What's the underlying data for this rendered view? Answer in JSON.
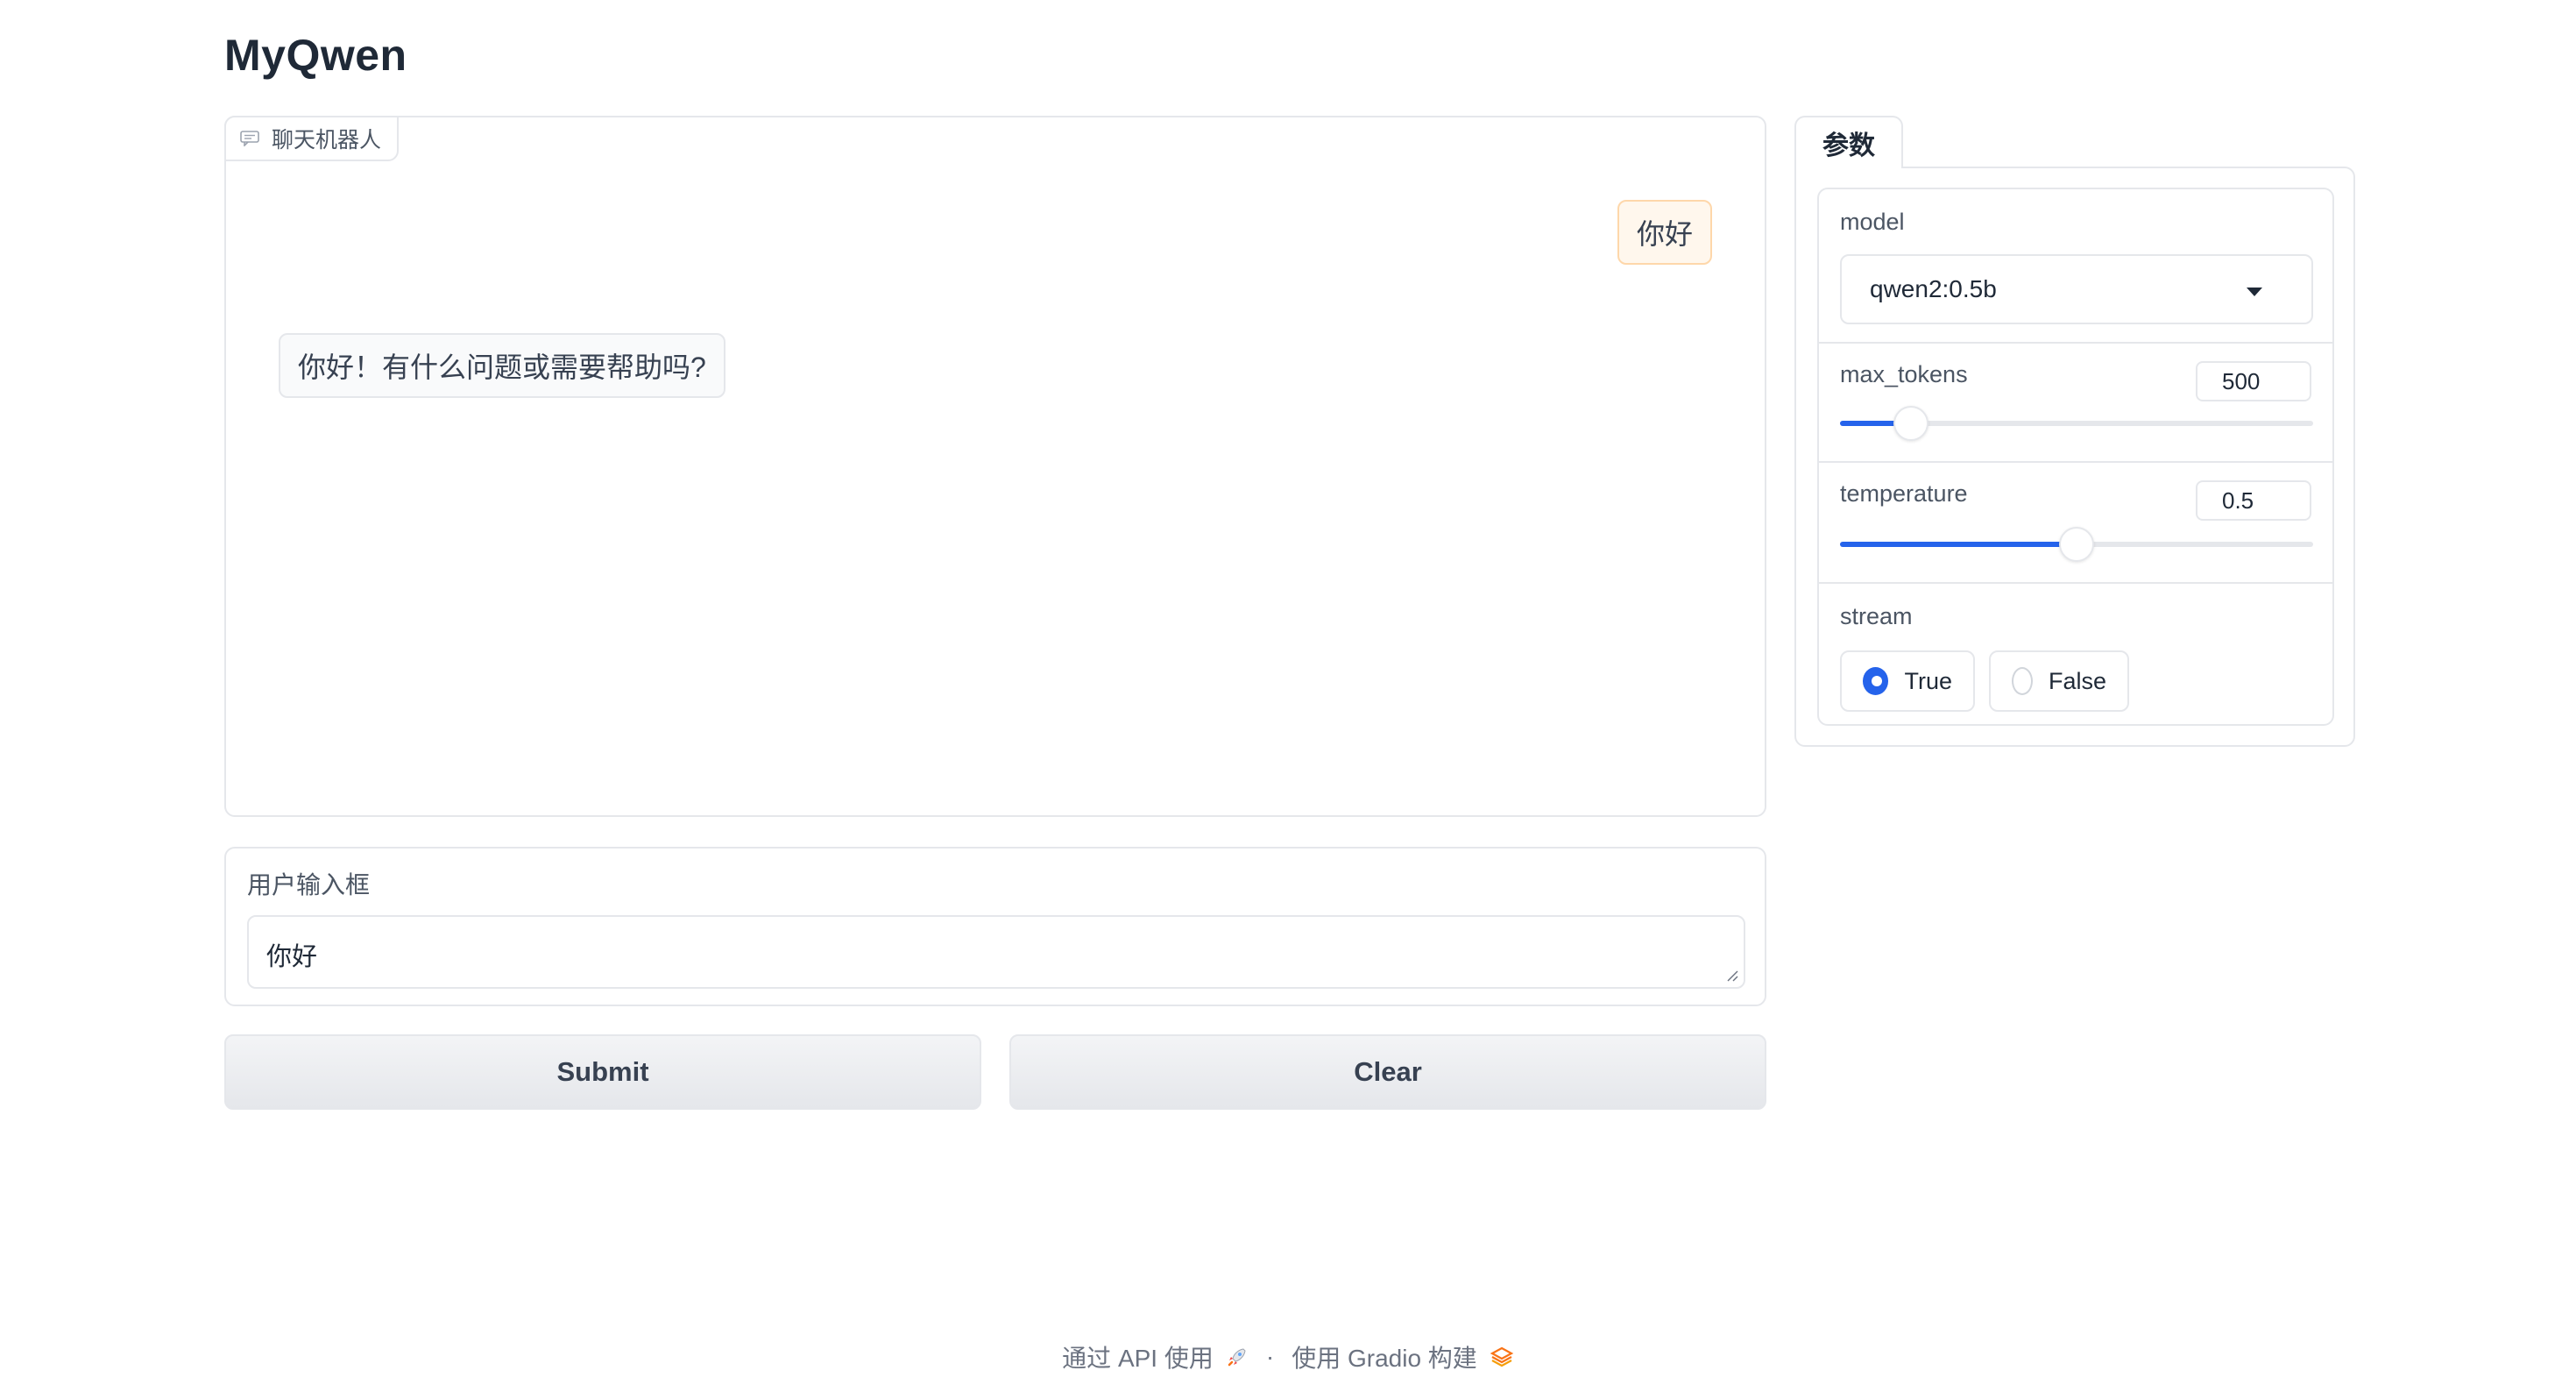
{
  "app": {
    "title": "MyQwen"
  },
  "chatbot": {
    "label": "聊天机器人",
    "messages": [
      {
        "role": "user",
        "text": "你好"
      },
      {
        "role": "bot",
        "text": "你好！有什么问题或需要帮助吗?"
      }
    ]
  },
  "input": {
    "label": "用户输入框",
    "value": "你好"
  },
  "buttons": {
    "submit": "Submit",
    "clear": "Clear"
  },
  "params": {
    "tab_label": "参数",
    "model": {
      "label": "model",
      "value": "qwen2:0.5b"
    },
    "max_tokens": {
      "label": "max_tokens",
      "value": "500",
      "fraction": 0.15
    },
    "temperature": {
      "label": "temperature",
      "value": "0.5",
      "fraction": 0.5
    },
    "stream": {
      "label": "stream",
      "options": [
        "True",
        "False"
      ],
      "selected": "True"
    }
  },
  "footer": {
    "api_text": "通过 API 使用",
    "separator": "·",
    "built_text": "使用 Gradio 构建"
  },
  "colors": {
    "accent": "#2563eb",
    "user_bubble": "#fff7ed",
    "gradio_logo": "#f97316"
  },
  "icons": [
    "chat-bubble-icon",
    "chevron-down-icon",
    "rocket-icon",
    "gradio-logo-icon"
  ]
}
